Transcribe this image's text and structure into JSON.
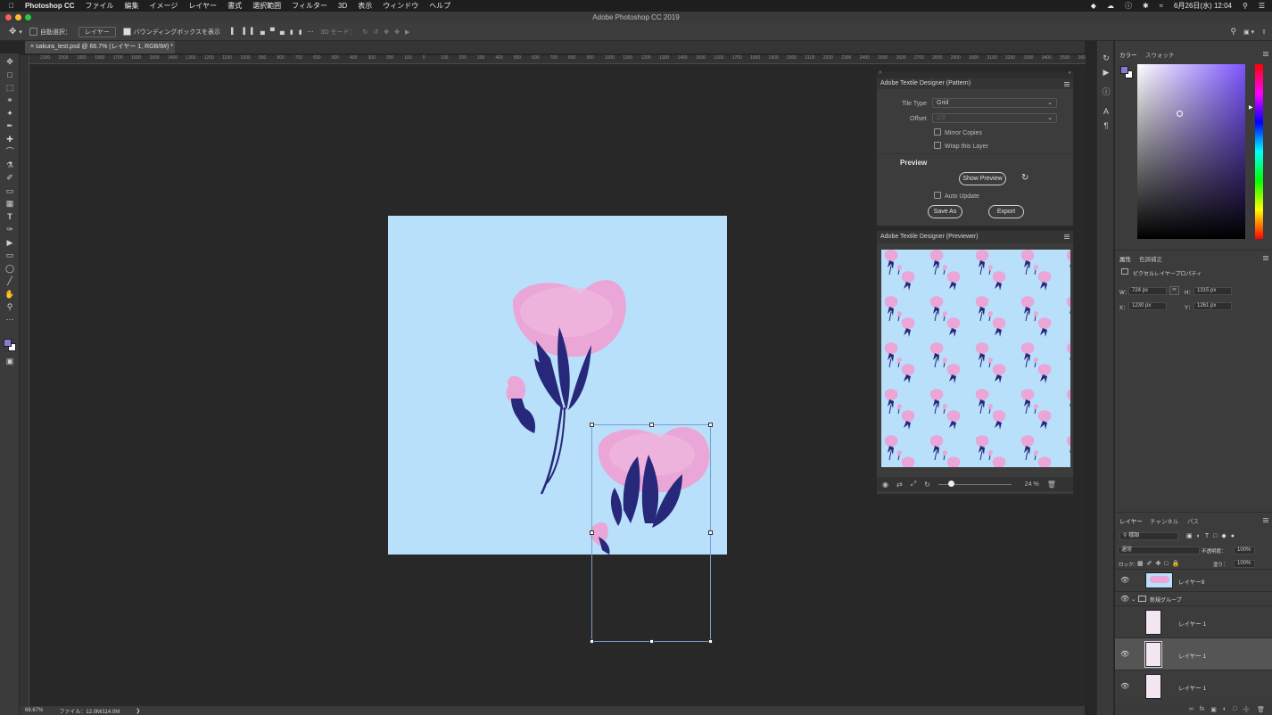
{
  "menubar": {
    "app_name": "Photoshop CC",
    "items": [
      "ファイル",
      "編集",
      "イメージ",
      "レイヤー",
      "書式",
      "選択範囲",
      "フィルター",
      "3D",
      "表示",
      "ウィンドウ",
      "ヘルプ"
    ],
    "clock": "6月26日(水) 12:04"
  },
  "window": {
    "title": "Adobe Photoshop CC 2019"
  },
  "options_bar": {
    "auto_select_label": "自動選択：",
    "auto_select_target": "レイヤー",
    "show_bbox_label": "バウンディングボックスを表示",
    "mode_3d_label": "3D モード："
  },
  "document_tab": {
    "label": "sakura_test.psd @ 66.7% (レイヤー 1, RGB/8#) *"
  },
  "ruler_ticks": [
    "2100",
    "2000",
    "1900",
    "1800",
    "1700",
    "1600",
    "1500",
    "1400",
    "1300",
    "1200",
    "1100",
    "1000",
    "900",
    "800",
    "700",
    "600",
    "500",
    "400",
    "300",
    "200",
    "100",
    "0",
    "100",
    "200",
    "300",
    "400",
    "500",
    "600",
    "700",
    "800",
    "900",
    "1000",
    "1100",
    "1200",
    "1300",
    "1400",
    "1500",
    "1600",
    "1700",
    "1800",
    "1900",
    "2000",
    "2100",
    "2200",
    "2300",
    "2400",
    "2500",
    "2600",
    "2700",
    "2800",
    "2900",
    "3000",
    "3100",
    "3200",
    "3300",
    "3400",
    "3500",
    "3600"
  ],
  "status_bar": {
    "zoom": "66.67%",
    "file_info": "ファイル：12.0M/114.0M"
  },
  "pattern_panel": {
    "title": "Adobe Textile Designer (Pattern)",
    "tile_type_label": "Tile Type",
    "tile_type_value": "Grid",
    "offset_label": "Offset",
    "offset_value": "1/2",
    "mirror_copies_label": "Mirror Copies",
    "wrap_layer_label": "Wrap this Layer",
    "preview_heading": "Preview",
    "show_preview_label": "Show Preview",
    "auto_update_label": "Auto Update",
    "save_as_label": "Save As",
    "export_label": "Export"
  },
  "previewer_panel": {
    "title": "Adobe Textile Designer (Previewer)",
    "zoom_percent": "24 %",
    "zoom_level": 0.15,
    "pattern_colors": {
      "background": "#b9e0fb",
      "petal": "#e9a6d6",
      "leaf": "#27287a"
    }
  },
  "color_panel": {
    "tabs": [
      "カラー",
      "スウォッチ"
    ],
    "hue_color": "#7b55ff",
    "foreground": "#8a7ad8",
    "background": "#ffffff"
  },
  "properties_panel": {
    "tabs": [
      "属性",
      "色調補正"
    ],
    "heading": "ピクセルレイヤープロパティ",
    "w_label": "W：",
    "w_value": "724 px",
    "h_label": "H：",
    "h_value": "1315 px",
    "x_label": "X：",
    "x_value": "1230 px",
    "y_label": "Y：",
    "y_value": "1261 px"
  },
  "layers_panel": {
    "tabs": [
      "レイヤー",
      "チャンネル",
      "パス"
    ],
    "filter_label": "種類",
    "blend_mode": "通常",
    "opacity_label": "不透明度：",
    "opacity_value": "100%",
    "lock_label": "ロック：",
    "fill_label": "塗り：",
    "fill_value": "100%",
    "group_name": "新規グループ",
    "layers": [
      {
        "name": "レイヤー9",
        "visible": true
      },
      {
        "name": "レイヤー 1",
        "visible": false
      },
      {
        "name": "レイヤー 1",
        "visible": true,
        "selected": true
      },
      {
        "name": "レイヤー 1",
        "visible": true
      }
    ]
  },
  "colors": {
    "artboard": "#b9e0fb",
    "petal": "#e9a6d6",
    "leaf": "#27287a",
    "selection": "#7a9cd0"
  }
}
